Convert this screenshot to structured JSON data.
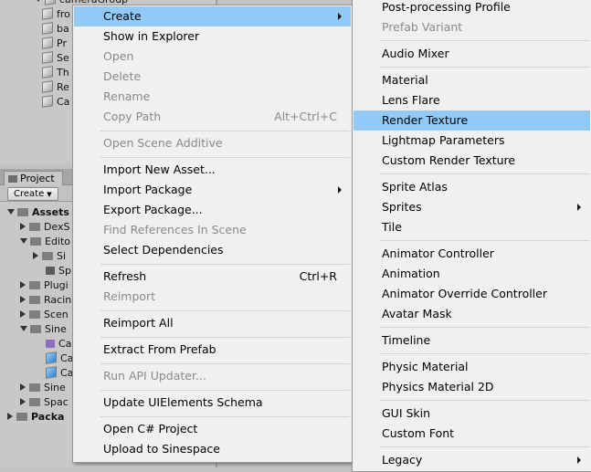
{
  "hierarchy": {
    "parent_label": "cameraGroup",
    "children": [
      "fro",
      "ba",
      "Pr",
      "Se",
      "Th",
      "Re",
      "Ca"
    ]
  },
  "project": {
    "tab_label": "Project",
    "create_label": "Create",
    "tree": [
      {
        "label": "Assets",
        "bold": true
      },
      {
        "label": "DexS"
      },
      {
        "label": "Edito"
      },
      {
        "label": "Si"
      },
      {
        "label": "Sp"
      },
      {
        "label": "Plugi"
      },
      {
        "label": "Racin"
      },
      {
        "label": "Scen"
      },
      {
        "label": "Sine"
      },
      {
        "label": "Ca"
      },
      {
        "label": "Ca"
      },
      {
        "label": "Ca"
      },
      {
        "label": "Sine"
      },
      {
        "label": "Spac"
      },
      {
        "label": "Packa",
        "bold": true
      }
    ]
  },
  "context_menu": {
    "items": [
      {
        "label": "Create",
        "submenu": true,
        "highlighted": true
      },
      {
        "label": "Show in Explorer"
      },
      {
        "label": "Open",
        "disabled": true
      },
      {
        "label": "Delete",
        "disabled": true
      },
      {
        "label": "Rename",
        "disabled": true
      },
      {
        "label": "Copy Path",
        "shortcut": "Alt+Ctrl+C",
        "disabled": true
      },
      {
        "label": "Open Scene Additive",
        "disabled": true
      },
      {
        "label": "Import New Asset..."
      },
      {
        "label": "Import Package",
        "submenu": true
      },
      {
        "label": "Export Package..."
      },
      {
        "label": "Find References In Scene",
        "disabled": true
      },
      {
        "label": "Select Dependencies"
      },
      {
        "label": "Refresh",
        "shortcut": "Ctrl+R"
      },
      {
        "label": "Reimport",
        "disabled": true
      },
      {
        "label": "Reimport All"
      },
      {
        "label": "Extract From Prefab"
      },
      {
        "label": "Run API Updater...",
        "disabled": true
      },
      {
        "label": "Update UIElements Schema"
      },
      {
        "label": "Open C# Project"
      },
      {
        "label": "Upload to Sinespace"
      }
    ]
  },
  "create_submenu": {
    "items": [
      {
        "label": "Post-processing Profile"
      },
      {
        "label": "Prefab Variant",
        "disabled": true
      },
      {
        "label": "Audio Mixer"
      },
      {
        "label": "Material"
      },
      {
        "label": "Lens Flare"
      },
      {
        "label": "Render Texture",
        "highlighted": true
      },
      {
        "label": "Lightmap Parameters"
      },
      {
        "label": "Custom Render Texture"
      },
      {
        "label": "Sprite Atlas"
      },
      {
        "label": "Sprites",
        "submenu": true
      },
      {
        "label": "Tile"
      },
      {
        "label": "Animator Controller"
      },
      {
        "label": "Animation"
      },
      {
        "label": "Animator Override Controller"
      },
      {
        "label": "Avatar Mask"
      },
      {
        "label": "Timeline"
      },
      {
        "label": "Physic Material"
      },
      {
        "label": "Physics Material 2D"
      },
      {
        "label": "GUI Skin"
      },
      {
        "label": "Custom Font"
      },
      {
        "label": "Legacy",
        "submenu": true
      }
    ]
  },
  "colors": {
    "highlight": "#91c9f7",
    "disabled_text": "#8a8a8a",
    "menu_background": "#f0f0f0"
  }
}
